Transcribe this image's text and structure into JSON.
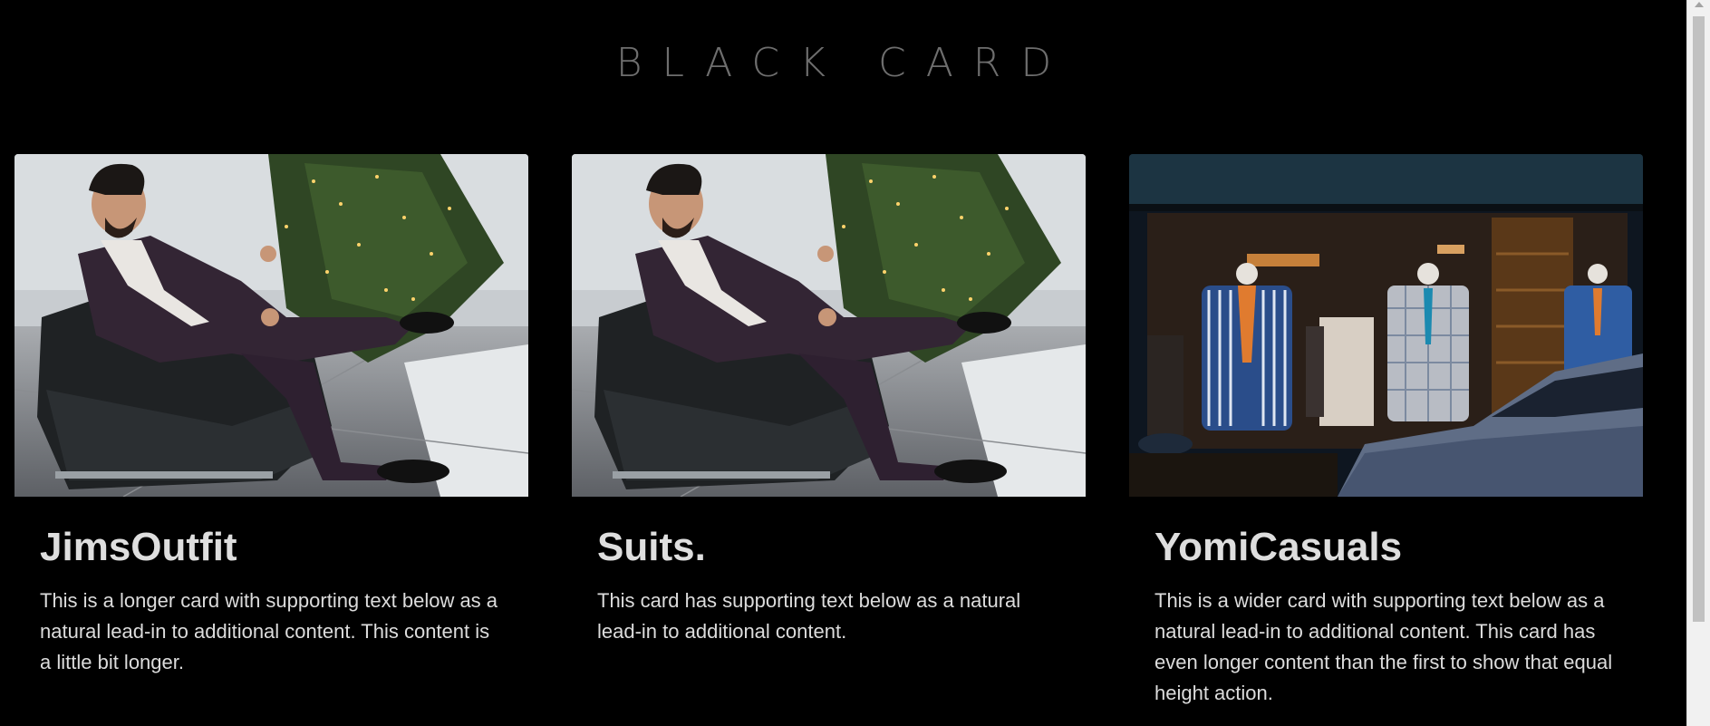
{
  "brand": {
    "title": "BLACK CARD"
  },
  "cards": [
    {
      "title": "JimsOutfit",
      "text": "This is a longer card with supporting text below as a natural lead-in to additional content. This content is a little bit longer.",
      "image": "man-in-suit-sitting-on-leather-chair-photo"
    },
    {
      "title": "Suits.",
      "text": "This card has supporting text below as a natural lead-in to additional content.",
      "image": "man-in-suit-sitting-on-leather-chair-photo"
    },
    {
      "title": "YomiCasuals",
      "text": "This is a wider card with supporting text below as a natural lead-in to additional content. This card has even longer content than the first to show that equal height action.",
      "image": "suit-shop-window-display-photo"
    }
  ],
  "colors": {
    "background": "#000000",
    "brand": "#6e6e6e",
    "title": "#dedede",
    "text": "#dcdcdc"
  }
}
